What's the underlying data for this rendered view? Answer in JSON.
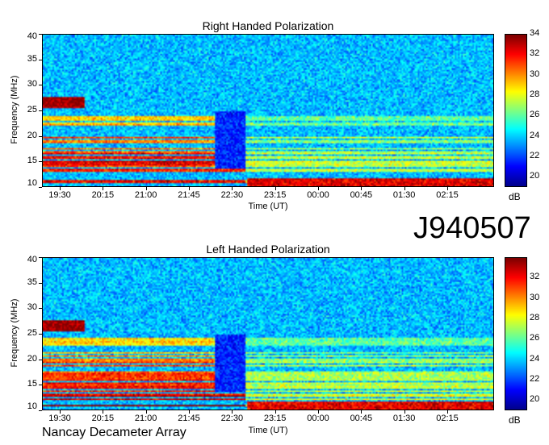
{
  "chart_data": [
    {
      "type": "heatmap",
      "title": "Right Handed Polarization",
      "xlabel": "Time (UT)",
      "ylabel": "Frequency (MHz)",
      "xticks": [
        "19:30",
        "20:15",
        "21:00",
        "21:45",
        "22:30",
        "23:15",
        "00:00",
        "00:45",
        "01:30",
        "02:15"
      ],
      "yticks": [
        10,
        15,
        20,
        25,
        30,
        35,
        40
      ],
      "ylim": [
        10,
        40
      ],
      "colorbar": {
        "unit": "dB",
        "range": [
          19,
          34
        ],
        "ticks": [
          20,
          22,
          24,
          26,
          28,
          30,
          32,
          34
        ]
      },
      "colormap": [
        "#00008f",
        "#0000ff",
        "#0080ff",
        "#00ffff",
        "#80ff80",
        "#ffff00",
        "#ff8000",
        "#ff0000",
        "#800000"
      ]
    },
    {
      "type": "heatmap",
      "title": "Left Handed Polarization",
      "xlabel": "Time (UT)",
      "ylabel": "Frequency (MHz)",
      "xticks": [
        "19:30",
        "20:15",
        "21:00",
        "21:45",
        "22:30",
        "23:15",
        "00:00",
        "00:45",
        "01:30",
        "02:15"
      ],
      "yticks": [
        10,
        15,
        20,
        25,
        30,
        35,
        40
      ],
      "ylim": [
        10,
        40
      ],
      "colorbar": {
        "unit": "dB",
        "range": [
          19,
          34
        ],
        "ticks": [
          20,
          22,
          24,
          26,
          28,
          30,
          32
        ]
      },
      "colormap": [
        "#00008f",
        "#0000ff",
        "#0080ff",
        "#00ffff",
        "#80ff80",
        "#ffff00",
        "#ff8000",
        "#ff0000",
        "#800000"
      ]
    }
  ],
  "observation_id": "J940507",
  "footer": "Nancay Decameter Array"
}
